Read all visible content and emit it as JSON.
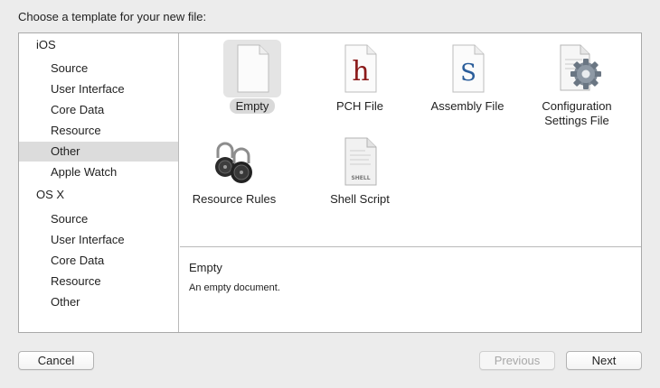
{
  "dialog": {
    "prompt": "Choose a template for your new file:"
  },
  "sidebar": {
    "sections": [
      {
        "header": "iOS",
        "items": [
          {
            "label": "Source"
          },
          {
            "label": "User Interface"
          },
          {
            "label": "Core Data"
          },
          {
            "label": "Resource"
          },
          {
            "label": "Other",
            "selected": true
          },
          {
            "label": "Apple Watch"
          }
        ]
      },
      {
        "header": "OS X",
        "items": [
          {
            "label": "Source"
          },
          {
            "label": "User Interface"
          },
          {
            "label": "Core Data"
          },
          {
            "label": "Resource"
          },
          {
            "label": "Other"
          }
        ]
      }
    ]
  },
  "templates": [
    {
      "label": "Empty",
      "icon": "blank-document-icon",
      "selected": true
    },
    {
      "label": "PCH File",
      "icon": "header-file-icon",
      "glyph": "h",
      "glyph_color": "#8b1a1a"
    },
    {
      "label": "Assembly File",
      "icon": "assembly-file-icon",
      "glyph": "S",
      "glyph_color": "#2a5d9a"
    },
    {
      "label": "Configuration Settings File",
      "icon": "config-settings-gear-icon"
    },
    {
      "label": "Resource Rules",
      "icon": "padlocks-icon"
    },
    {
      "label": "Shell Script",
      "icon": "shell-script-icon",
      "glyph": "SHELL"
    }
  ],
  "description": {
    "title": "Empty",
    "text": "An empty document."
  },
  "buttons": {
    "cancel": "Cancel",
    "previous": "Previous",
    "next": "Next"
  }
}
